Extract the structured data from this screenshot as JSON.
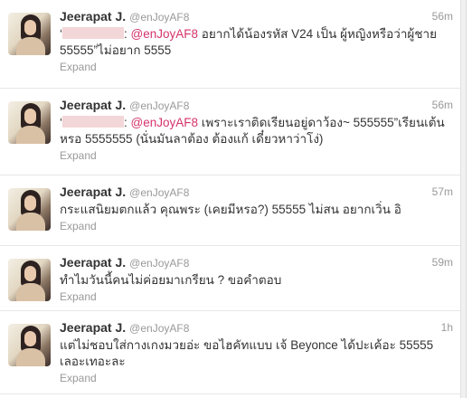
{
  "tweets": [
    {
      "name": "Jeerapat J.",
      "handle": "@enJoyAF8",
      "time": "56m",
      "pre": "‘",
      "mid": ": ",
      "mention": "@enJoyAF8",
      "post": " อยากได้น้องรหัส V24 เป็น ผู้หญิงหรือว่าผู้ชาย 55555”ไม่อยาก 5555",
      "expand": "Expand"
    },
    {
      "name": "Jeerapat J.",
      "handle": "@enJoyAF8",
      "time": "56m",
      "pre": "‘",
      "mid": ": ",
      "mention": "@enJoyAF8",
      "post": " เพราะเราติดเรียนอยู่ดาว้อง~ 555555”เรียนเต้นหรอ 5555555 (นั่นมันลาต้อง ต้องแก้ เดี๋ยวหาว่าโง่)",
      "expand": "Expand"
    },
    {
      "name": "Jeerapat J.",
      "handle": "@enJoyAF8",
      "time": "57m",
      "text": "กระแสนิยมตกแล้ว คุณพระ (เคยมีหรอ?) 55555 ไม่สน อยากเวิ่น อิ",
      "expand": "Expand"
    },
    {
      "name": "Jeerapat J.",
      "handle": "@enJoyAF8",
      "time": "59m",
      "text": "ทำไมวันนี้คนไม่ค่อยมาเกรียน ? ขอคำตอบ",
      "expand": "Expand"
    },
    {
      "name": "Jeerapat J.",
      "handle": "@enJoyAF8",
      "time": "1h",
      "text": "แต่ไม่ชอบใส่กางเกงมวยอ่ะ ขอไฮคัทแบบ เจ้ Beyonce ได้ปะเค้อะ 55555 เลอะเทอะละ",
      "expand": "Expand"
    }
  ]
}
